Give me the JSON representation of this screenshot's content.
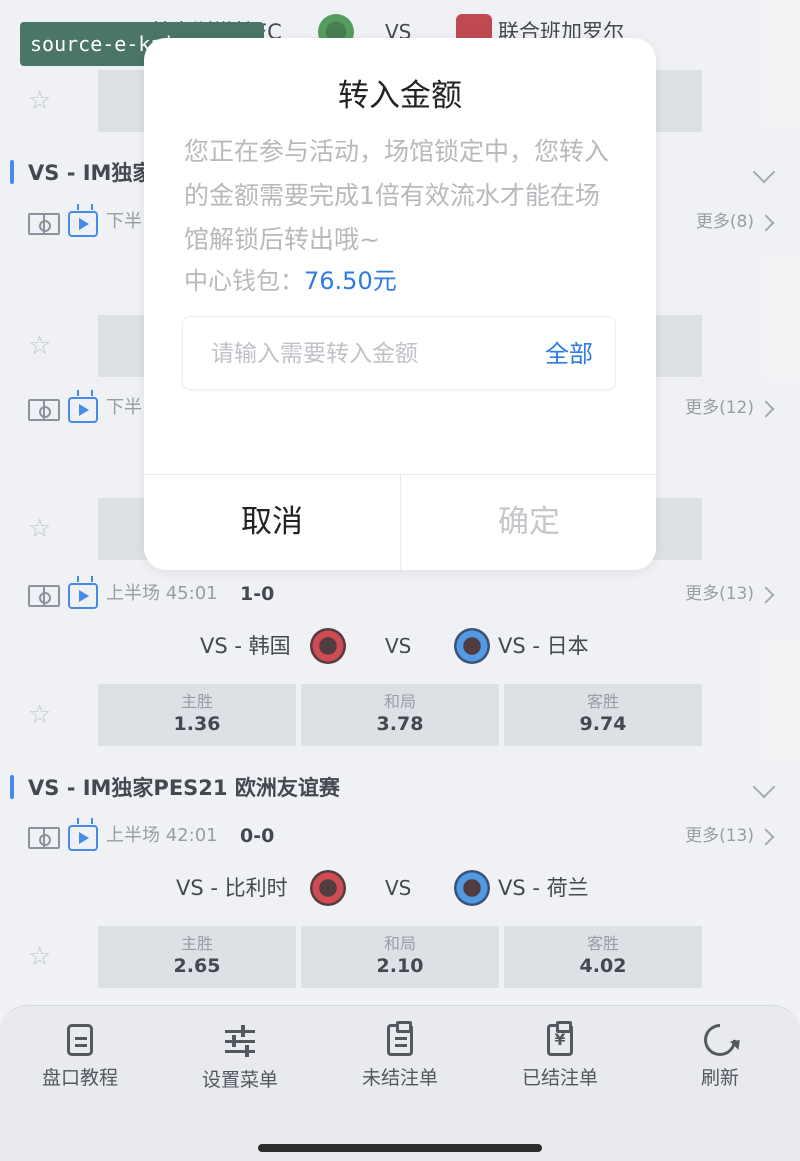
{
  "watermark": "source-e-kaiyun.com",
  "top_match": {
    "home": "基克斯塔特FC",
    "vs": "VS",
    "away": "联合班加罗尔"
  },
  "sections": [
    {
      "title": "VS - IM独家",
      "rows": [
        {
          "period": "下半",
          "more": "更多(8)"
        },
        {
          "period": "下半",
          "more": "更多(12)"
        },
        {
          "period": "上半场 45:01",
          "score": "1-0",
          "more": "更多(13)",
          "home": "VS - 韩国",
          "vs": "VS",
          "away": "VS - 日本",
          "odds": [
            {
              "label": "主胜",
              "value": "1.36"
            },
            {
              "label": "和局",
              "value": "3.78"
            },
            {
              "label": "客胜",
              "value": "9.74"
            }
          ]
        }
      ]
    },
    {
      "title": "VS - IM独家PES21 欧洲友谊赛",
      "rows": [
        {
          "period": "上半场 42:01",
          "score": "0-0",
          "more": "更多(13)",
          "home": "VS - 比利时",
          "vs": "VS",
          "away": "VS - 荷兰",
          "odds": [
            {
              "label": "主胜",
              "value": "2.65"
            },
            {
              "label": "和局",
              "value": "2.10"
            },
            {
              "label": "客胜",
              "value": "4.02"
            }
          ]
        }
      ]
    }
  ],
  "bottom_nav": [
    {
      "label": "盘口教程",
      "icon": "document-icon"
    },
    {
      "label": "设置菜单",
      "icon": "sliders-icon"
    },
    {
      "label": "未结注单",
      "icon": "clipboard-icon"
    },
    {
      "label": "已结注单",
      "icon": "yen-clipboard-icon"
    },
    {
      "label": "刷新",
      "icon": "refresh-icon"
    }
  ],
  "modal": {
    "title": "转入金额",
    "message": "您正在参与活动，场馆锁定中，您转入的金额需要完成1倍有效流水才能在场馆解锁后转出哦~",
    "wallet_label": "中心钱包：",
    "wallet_amount": "76.50元",
    "input_placeholder": "请输入需要转入金额",
    "input_value": "",
    "all_label": "全部",
    "cancel_label": "取消",
    "confirm_label": "确定"
  },
  "colors": {
    "accent": "#2d7be5",
    "disabled": "#c5c7cb",
    "watermark_bg": "#4b7566"
  }
}
